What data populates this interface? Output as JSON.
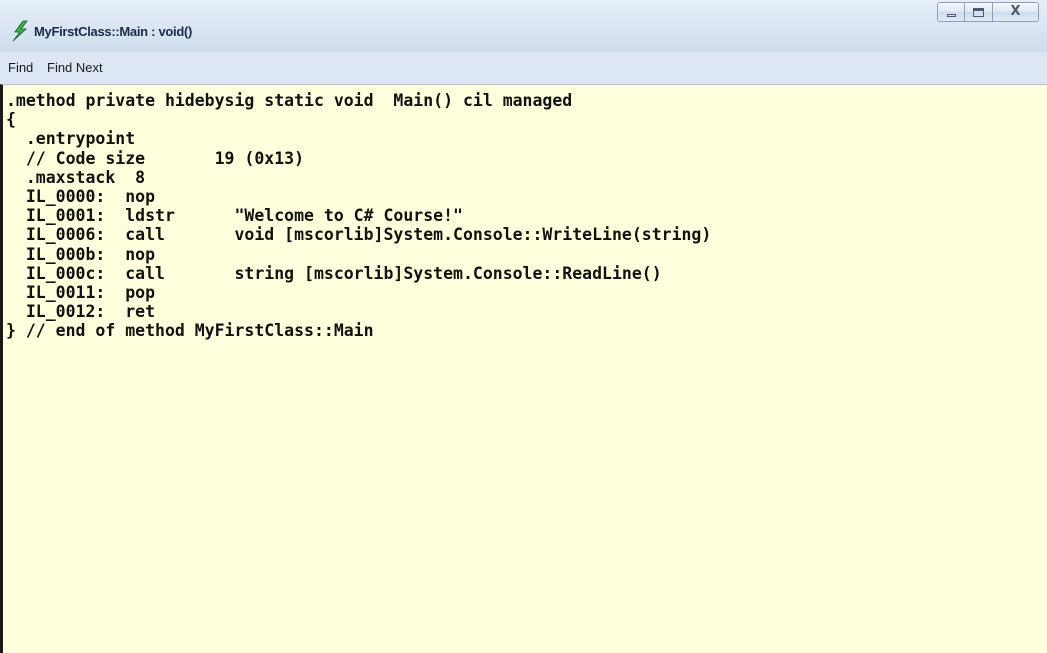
{
  "window": {
    "title": "MyFirstClass::Main : void()",
    "controls": {
      "minimize_icon": "minimize-icon",
      "maximize_icon": "maximize-icon",
      "close_glyph": "X"
    }
  },
  "menu": {
    "items": [
      {
        "label": "Find"
      },
      {
        "label": "Find Next"
      }
    ]
  },
  "editor": {
    "background": "#ffffdd",
    "lines": [
      ".method private hidebysig static void  Main() cil managed",
      "{",
      "  .entrypoint",
      "  // Code size       19 (0x13)",
      "  .maxstack  8",
      "  IL_0000:  nop",
      "  IL_0001:  ldstr      \"Welcome to C# Course!\"",
      "  IL_0006:  call       void [mscorlib]System.Console::WriteLine(string)",
      "  IL_000b:  nop",
      "  IL_000c:  call       string [mscorlib]System.Console::ReadLine()",
      "  IL_0011:  pop",
      "  IL_0012:  ret",
      "} // end of method MyFirstClass::Main"
    ]
  }
}
